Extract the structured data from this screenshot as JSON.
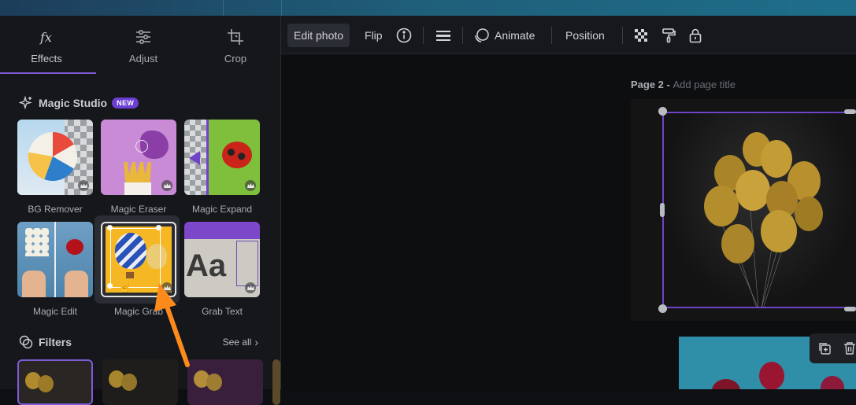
{
  "tabs": [
    {
      "label": "Effects",
      "icon": "fx-icon"
    },
    {
      "label": "Adjust",
      "icon": "sliders-icon"
    },
    {
      "label": "Crop",
      "icon": "crop-icon"
    }
  ],
  "magic_studio": {
    "title": "Magic Studio",
    "badge": "NEW"
  },
  "tools": [
    {
      "label": "BG Remover"
    },
    {
      "label": "Magic Eraser"
    },
    {
      "label": "Magic Expand"
    },
    {
      "label": "Magic Edit"
    },
    {
      "label": "Magic Grab"
    },
    {
      "label": "Grab Text"
    }
  ],
  "filters": {
    "title": "Filters",
    "see_all": "See all"
  },
  "toolbar": {
    "edit_photo": "Edit photo",
    "flip": "Flip",
    "animate": "Animate",
    "position": "Position"
  },
  "page": {
    "label": "Page 2 - ",
    "placeholder": "Add page title"
  },
  "grab_text_sample": "Aa",
  "colors": {
    "accent": "#7d5cd6",
    "arrow": "#ff8a1c",
    "badge": "#6b3fd4"
  }
}
